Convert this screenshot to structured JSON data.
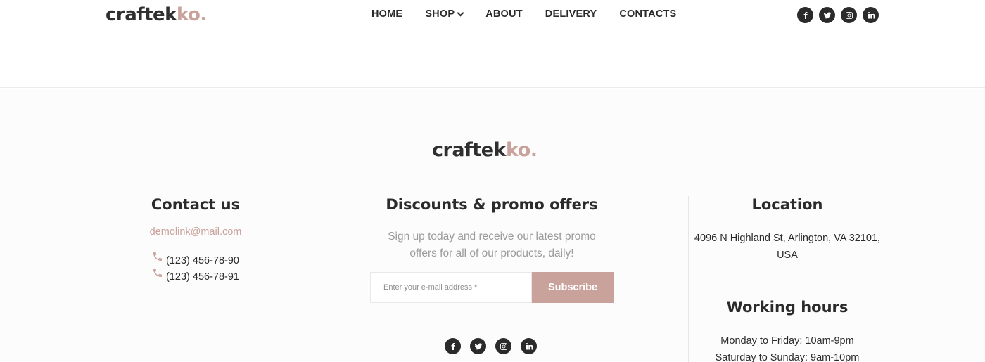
{
  "brand": {
    "name_main": "craftek",
    "name_accent": "ko."
  },
  "nav": {
    "items": [
      {
        "label": "HOME"
      },
      {
        "label": "SHOP",
        "has_dropdown": true
      },
      {
        "label": "ABOUT"
      },
      {
        "label": "DELIVERY"
      },
      {
        "label": "CONTACTS"
      }
    ]
  },
  "social_icons": [
    "facebook-icon",
    "twitter-icon",
    "instagram-icon",
    "linkedin-icon"
  ],
  "footer": {
    "contact": {
      "title": "Contact us",
      "email": "demolink@mail.com",
      "phones": [
        "(123) 456-78-90",
        "(123) 456-78-91"
      ]
    },
    "promo": {
      "title": "Discounts & promo offers",
      "text": "Sign up today and receive our latest promo offers for all of our products, daily!",
      "input_placeholder": "Enter your e-mail address *",
      "button_label": "Subscribe"
    },
    "location": {
      "title": "Location",
      "address": "4096 N Highland St, Arlington, VA 32101, USA"
    },
    "hours": {
      "title": "Working hours",
      "lines": [
        "Monday to Friday: 10am-9pm",
        "Saturday to Sunday: 9am-10pm"
      ]
    }
  },
  "colors": {
    "accent": "#c8a29b",
    "dark": "#2b2b2b",
    "muted": "#9b9b9b"
  }
}
